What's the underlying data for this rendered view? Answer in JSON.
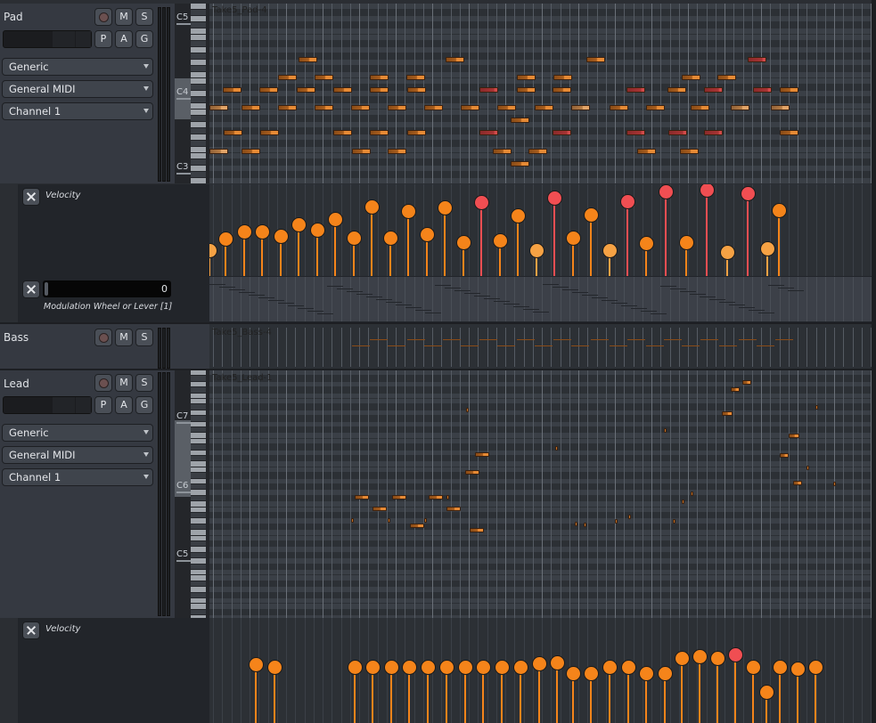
{
  "tracks": [
    {
      "name": "Pad",
      "buttons": {
        "record": "record-button",
        "mute": "M",
        "solo": "S",
        "p": "P",
        "a": "A",
        "g": "G"
      },
      "instrument": "Generic",
      "bank": "General MIDI",
      "channel": "Channel  1",
      "key_labels": [
        "C5",
        "C4",
        "C3"
      ],
      "clip_name": "Take5_Pad-4",
      "lanes": {
        "velocity_label": "Velocity",
        "cc_label": "Modulation Wheel or Lever [1]",
        "cc_value": "0"
      }
    },
    {
      "name": "Bass",
      "buttons": {
        "record": "record-button",
        "mute": "M",
        "solo": "S"
      },
      "clip_name": "Take5_Bass-4"
    },
    {
      "name": "Lead",
      "buttons": {
        "record": "record-button",
        "mute": "M",
        "solo": "S",
        "p": "P",
        "a": "A",
        "g": "G"
      },
      "instrument": "Generic",
      "bank": "General MIDI",
      "channel": "Channel  1",
      "key_labels": [
        "C7",
        "C6",
        "C5"
      ],
      "clip_name": "Take5_Lead-1",
      "lanes": {
        "velocity_label": "Velocity"
      }
    }
  ],
  "colors": {
    "note_orange": "#e68a35",
    "note_red": "#d04a4a",
    "note_light": "#e2a468",
    "velocity_orange": "#f5841a",
    "velocity_red": "#f04e52",
    "velocity_light": "#f6a244"
  },
  "pad_velocities": [
    {
      "v": 0.32,
      "c": "light"
    },
    {
      "v": 0.45,
      "c": "o"
    },
    {
      "v": 0.52,
      "c": "o"
    },
    {
      "v": 0.52,
      "c": "o"
    },
    {
      "v": 0.48,
      "c": "o"
    },
    {
      "v": 0.6,
      "c": "o"
    },
    {
      "v": 0.54,
      "c": "o"
    },
    {
      "v": 0.66,
      "c": "o"
    },
    {
      "v": 0.46,
      "c": "o"
    },
    {
      "v": 0.8,
      "c": "o"
    },
    {
      "v": 0.46,
      "c": "o"
    },
    {
      "v": 0.75,
      "c": "o"
    },
    {
      "v": 0.5,
      "c": "o"
    },
    {
      "v": 0.79,
      "c": "o"
    },
    {
      "v": 0.41,
      "c": "o"
    },
    {
      "v": 0.84,
      "c": "red"
    },
    {
      "v": 0.43,
      "c": "o"
    },
    {
      "v": 0.7,
      "c": "o"
    },
    {
      "v": 0.32,
      "c": "light"
    },
    {
      "v": 0.89,
      "c": "red"
    },
    {
      "v": 0.46,
      "c": "o"
    },
    {
      "v": 0.71,
      "c": "o"
    },
    {
      "v": 0.32,
      "c": "light"
    },
    {
      "v": 0.85,
      "c": "red"
    },
    {
      "v": 0.4,
      "c": "o"
    },
    {
      "v": 0.96,
      "c": "red"
    },
    {
      "v": 0.41,
      "c": "o"
    },
    {
      "v": 0.98,
      "c": "red"
    },
    {
      "v": 0.3,
      "c": "light"
    },
    {
      "v": 0.94,
      "c": "red"
    },
    {
      "v": 0.34,
      "c": "light"
    },
    {
      "v": 0.76,
      "c": "o"
    }
  ],
  "lead_velocities": [
    0.68,
    0.63,
    0.63,
    0.63,
    0.63,
    0.63,
    0.63,
    0.63,
    0.63,
    0.63,
    0.63,
    0.63,
    0.63,
    0.66
  ]
}
